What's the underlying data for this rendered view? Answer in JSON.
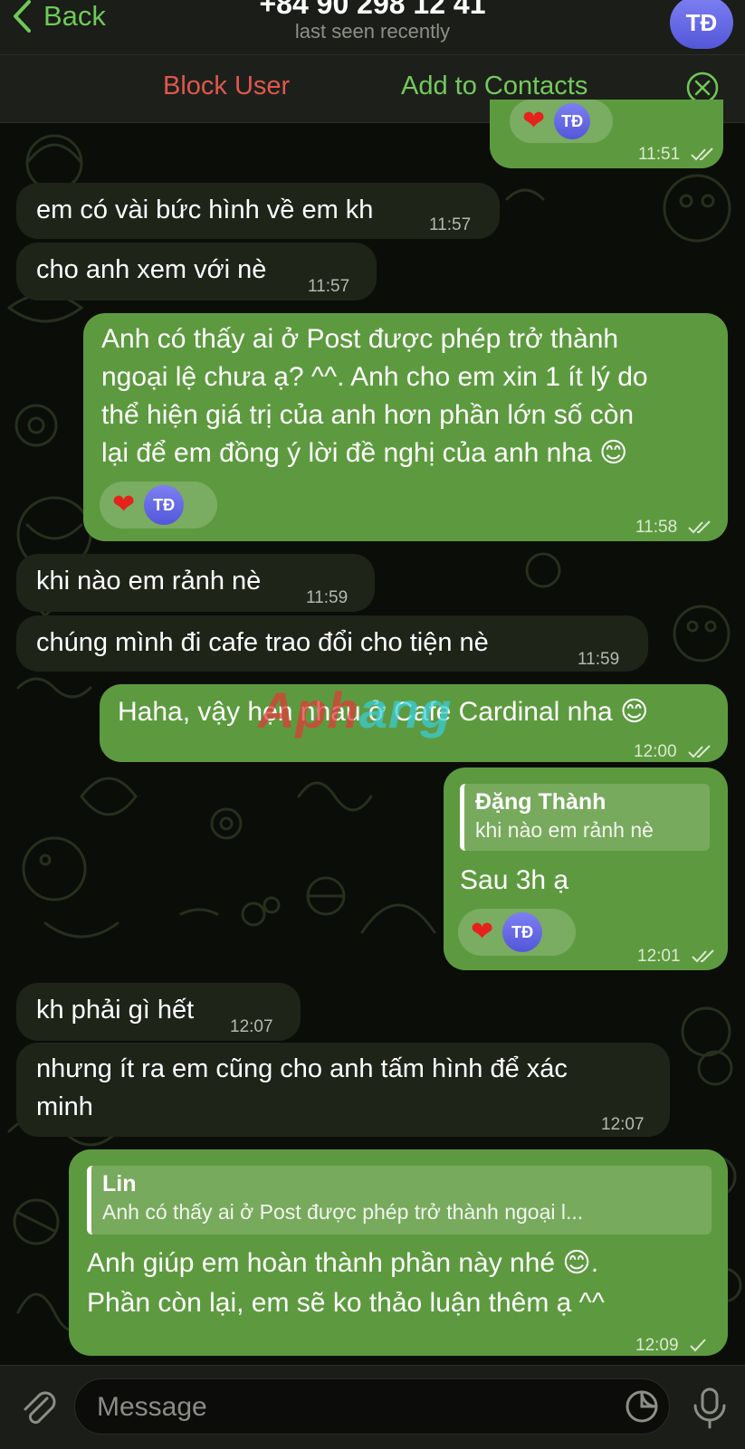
{
  "header": {
    "back_label": "Back",
    "peer_name": "+84 90 298 12 41",
    "peer_status": "last seen recently",
    "avatar_initials": "TĐ"
  },
  "action_bar": {
    "block_label": "Block User",
    "add_contact_label": "Add to Contacts"
  },
  "messages": [
    {
      "dir": "out",
      "text": "",
      "time": "11:51",
      "reaction": "❤️",
      "reactor": "TĐ"
    },
    {
      "dir": "in",
      "text": "em có vài bức hình về em kh",
      "time": "11:57"
    },
    {
      "dir": "in",
      "text": "cho anh xem với nè",
      "time": "11:57"
    },
    {
      "dir": "out",
      "lines": [
        "Anh có thấy ai ở Post được phép trở thành",
        "ngoại lệ chưa ạ? ^^. Anh cho em xin 1 ít lý do",
        "thể hiện giá trị của anh hơn phần lớn số còn",
        "lại để em đồng ý lời đề nghị của anh nha 😊"
      ],
      "time": "11:58",
      "reaction": "❤️",
      "reactor": "TĐ"
    },
    {
      "dir": "in",
      "text": "khi nào em rảnh nè",
      "time": "11:59"
    },
    {
      "dir": "in",
      "text": "chúng mình đi cafe trao đổi cho tiện nè",
      "time": "11:59"
    },
    {
      "dir": "out",
      "text": "Haha, vậy hẹn nhau ở Cafe Cardinal nha 😊",
      "time": "12:00"
    },
    {
      "dir": "out",
      "reply_name": "Đặng Thành",
      "reply_text": "khi nào em rảnh nè",
      "text": "Sau 3h ạ",
      "time": "12:01",
      "reaction": "❤️",
      "reactor": "TĐ"
    },
    {
      "dir": "in",
      "text": "kh phải gì hết",
      "time": "12:07"
    },
    {
      "dir": "in",
      "lines": [
        "nhưng ít ra em cũng cho anh tấm hình để xác",
        "minh"
      ],
      "time": "12:07"
    },
    {
      "dir": "out",
      "reply_name": "Lin",
      "reply_text": "Anh có thấy ai ở Post được phép trở thành ngoại l...",
      "lines": [
        "Anh giúp em hoàn thành phần này nhé 😊.",
        "Phần còn lại, em sẽ ko thảo luận thêm ạ ^^"
      ],
      "time": "12:09"
    }
  ],
  "watermark": {
    "part1": "Aph",
    "part2": "ang"
  },
  "composer": {
    "placeholder": "Message"
  },
  "colors": {
    "accent": "#6fc957",
    "danger": "#e0574d",
    "outgoing_bubble": "#5d9a3f",
    "incoming_bubble": "#1f2419",
    "background": "#0b0d09"
  },
  "icons": [
    "chevron-left-icon",
    "close-circle-icon",
    "double-check-icon",
    "single-check-icon",
    "heart-icon",
    "paperclip-icon",
    "sticker-icon",
    "microphone-icon"
  ]
}
